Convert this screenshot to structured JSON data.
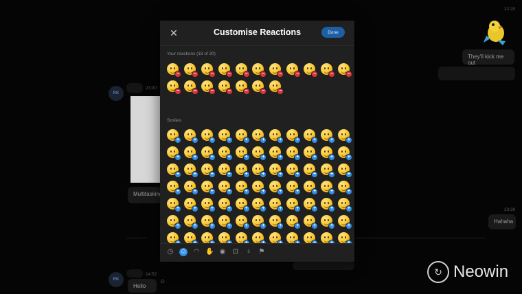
{
  "modal": {
    "title": "Customise Reactions",
    "done_label": "Done",
    "close_icon": "close-icon",
    "your_reactions_label": "Your reactions (18 of 30)",
    "your_reactions_count": 18,
    "smilies_label": "Smilies",
    "smilies_visible_count": 77,
    "categories": [
      {
        "icon": "recent-clock-icon",
        "glyph": "◷"
      },
      {
        "icon": "smiley-icon",
        "glyph": "☺",
        "active": true
      },
      {
        "icon": "animals-icon",
        "glyph": "◠"
      },
      {
        "icon": "gesture-icon",
        "glyph": "✋"
      },
      {
        "icon": "food-icon",
        "glyph": "◉"
      },
      {
        "icon": "travel-icon",
        "glyph": "⊡"
      },
      {
        "icon": "lightbulb-icon",
        "glyph": "♀"
      },
      {
        "icon": "flag-icon",
        "glyph": "⚑"
      }
    ]
  },
  "background_chat": {
    "messages": [
      {
        "text": "They'll kick me out"
      },
      {
        "text": "Hahaha"
      },
      {
        "text": "Multitasking"
      },
      {
        "text": "Hello"
      }
    ],
    "times": [
      "22:20",
      "23:30",
      "23:30",
      "14:52"
    ],
    "avatar_initials": "RK"
  },
  "watermark": {
    "brand": "Neowin"
  },
  "colors": {
    "accent": "#2f8fe8",
    "remove": "#d9363e",
    "modal_bg": "#202020"
  }
}
